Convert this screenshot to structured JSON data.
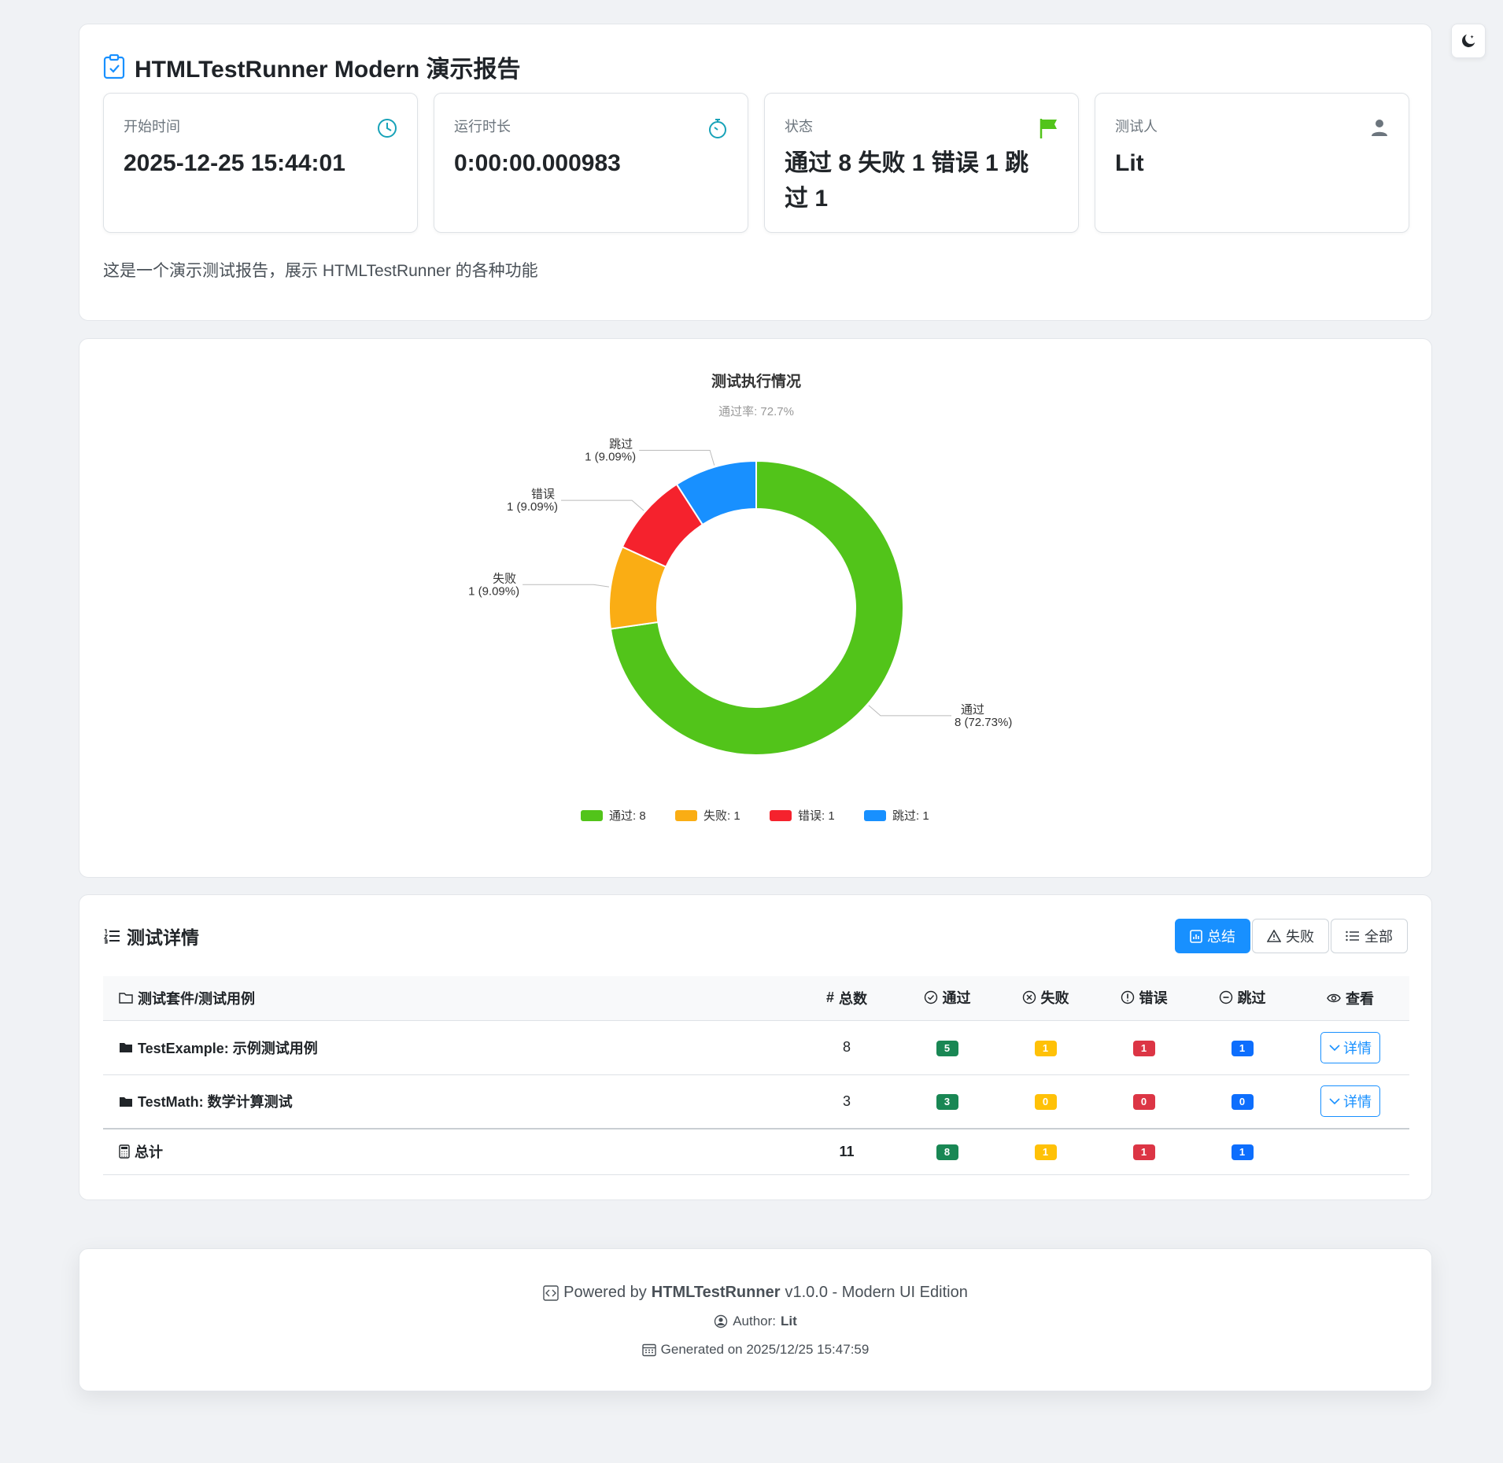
{
  "header": {
    "title": "HTMLTestRunner Modern 演示报告",
    "description": "这是一个演示测试报告，展示 HTMLTestRunner 的各种功能"
  },
  "stats": [
    {
      "label": "开始时间",
      "value": "2025-12-25 15:44:01",
      "icon": "clock-icon",
      "color": "#17a2b8"
    },
    {
      "label": "运行时长",
      "value": "0:00:00.000983",
      "icon": "stopwatch-icon",
      "color": "#17a2b8"
    },
    {
      "label": "状态",
      "value": "通过 8 失败 1 错误 1 跳过 1",
      "icon": "flag-icon",
      "color": "#52c41a"
    },
    {
      "label": "测试人",
      "value": "Lit",
      "icon": "person-icon",
      "color": "#6c757d"
    }
  ],
  "chart_data": {
    "type": "pie",
    "title": "测试执行情况",
    "subtitle": "通过率: 72.7%",
    "slices": [
      {
        "name": "通过",
        "value": 8,
        "percent": "72.73%",
        "color": "#52c41a"
      },
      {
        "name": "失败",
        "value": 1,
        "percent": "9.09%",
        "color": "#faad14"
      },
      {
        "name": "错误",
        "value": 1,
        "percent": "9.09%",
        "color": "#f5222d"
      },
      {
        "name": "跳过",
        "value": 1,
        "percent": "9.09%",
        "color": "#1890ff"
      }
    ],
    "legend": [
      "通过: 8",
      "失败: 1",
      "错误: 1",
      "跳过: 1"
    ],
    "legend_position": "bottom"
  },
  "details": {
    "title": "测试详情",
    "buttons": {
      "summary": "总结",
      "failed": "失败",
      "all": "全部"
    },
    "columns": {
      "name": "测试套件/测试用例",
      "total": "总数",
      "pass": "通过",
      "fail": "失败",
      "error": "错误",
      "skip": "跳过",
      "view": "查看"
    },
    "rows": [
      {
        "name": "TestExample: 示例测试用例",
        "total": "8",
        "pass": "5",
        "fail": "1",
        "error": "1",
        "skip": "1",
        "action": "详情"
      },
      {
        "name": "TestMath: 数学计算测试",
        "total": "3",
        "pass": "3",
        "fail": "0",
        "error": "0",
        "skip": "0",
        "action": "详情"
      }
    ],
    "total_row": {
      "name": "总计",
      "total": "11",
      "pass": "8",
      "fail": "1",
      "error": "1",
      "skip": "1"
    }
  },
  "footer": {
    "powered_prefix": "Powered by",
    "powered_name": "HTMLTestRunner",
    "powered_suffix": "v1.0.0 - Modern UI Edition",
    "author_label": "Author:",
    "author_name": "Lit",
    "generated": "Generated on 2025/12/25 15:47:59"
  }
}
